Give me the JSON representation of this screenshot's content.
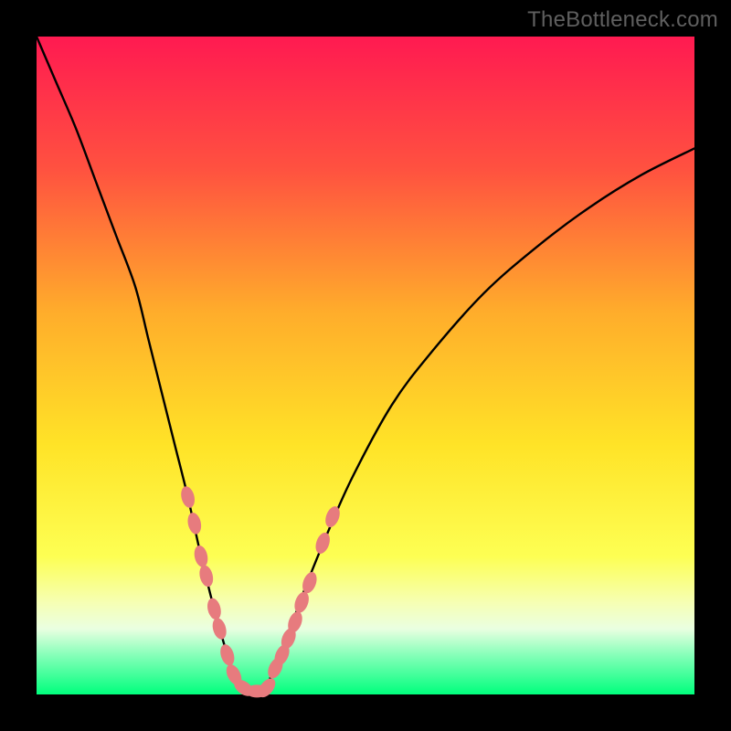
{
  "watermark": {
    "text": "TheBottleneck.com"
  },
  "colors": {
    "background": "#000000",
    "curve_stroke": "#000000",
    "marker_fill": "#e77b7e",
    "marker_stroke": "#d96a6d",
    "gradient_stops": [
      {
        "pct": 0,
        "color": "#ff1a51"
      },
      {
        "pct": 20,
        "color": "#ff5140"
      },
      {
        "pct": 42,
        "color": "#ffad2b"
      },
      {
        "pct": 62,
        "color": "#ffe327"
      },
      {
        "pct": 79,
        "color": "#fdff53"
      },
      {
        "pct": 86,
        "color": "#f6ffb3"
      },
      {
        "pct": 90,
        "color": "#eaffe1"
      },
      {
        "pct": 94,
        "color": "#86ffb9"
      },
      {
        "pct": 100,
        "color": "#00ff7d"
      }
    ]
  },
  "chart_data": {
    "type": "line",
    "title": "",
    "xlabel": "",
    "ylabel": "",
    "xlim": [
      0,
      100
    ],
    "ylim": [
      0,
      100
    ],
    "series": [
      {
        "name": "bottleneck-curve",
        "x": [
          0,
          3,
          6,
          9,
          12,
          15,
          17,
          19,
          21,
          23,
          25,
          27,
          29,
          30,
          31,
          32,
          33.5,
          35,
          36,
          38,
          40,
          44,
          48,
          54,
          60,
          68,
          76,
          84,
          92,
          100
        ],
        "values": [
          100,
          93,
          86,
          78,
          70,
          62,
          54,
          46,
          38,
          30,
          21,
          13,
          6,
          3,
          1,
          0.5,
          0.5,
          1,
          4,
          8,
          14,
          24,
          33,
          44,
          52,
          61,
          68,
          74,
          79,
          83
        ]
      }
    ],
    "markers": {
      "name": "highlighted-points",
      "x": [
        23,
        24,
        25,
        25.8,
        27,
        27.8,
        29,
        30,
        31.5,
        33.5,
        35,
        36.3,
        37.3,
        38.3,
        39.3,
        40.3,
        41.5,
        43.5,
        45
      ],
      "values": [
        30,
        26,
        21,
        18,
        13,
        10,
        6,
        3,
        1,
        0.5,
        1,
        4,
        6,
        8.5,
        11,
        14,
        17,
        23,
        27
      ]
    }
  }
}
